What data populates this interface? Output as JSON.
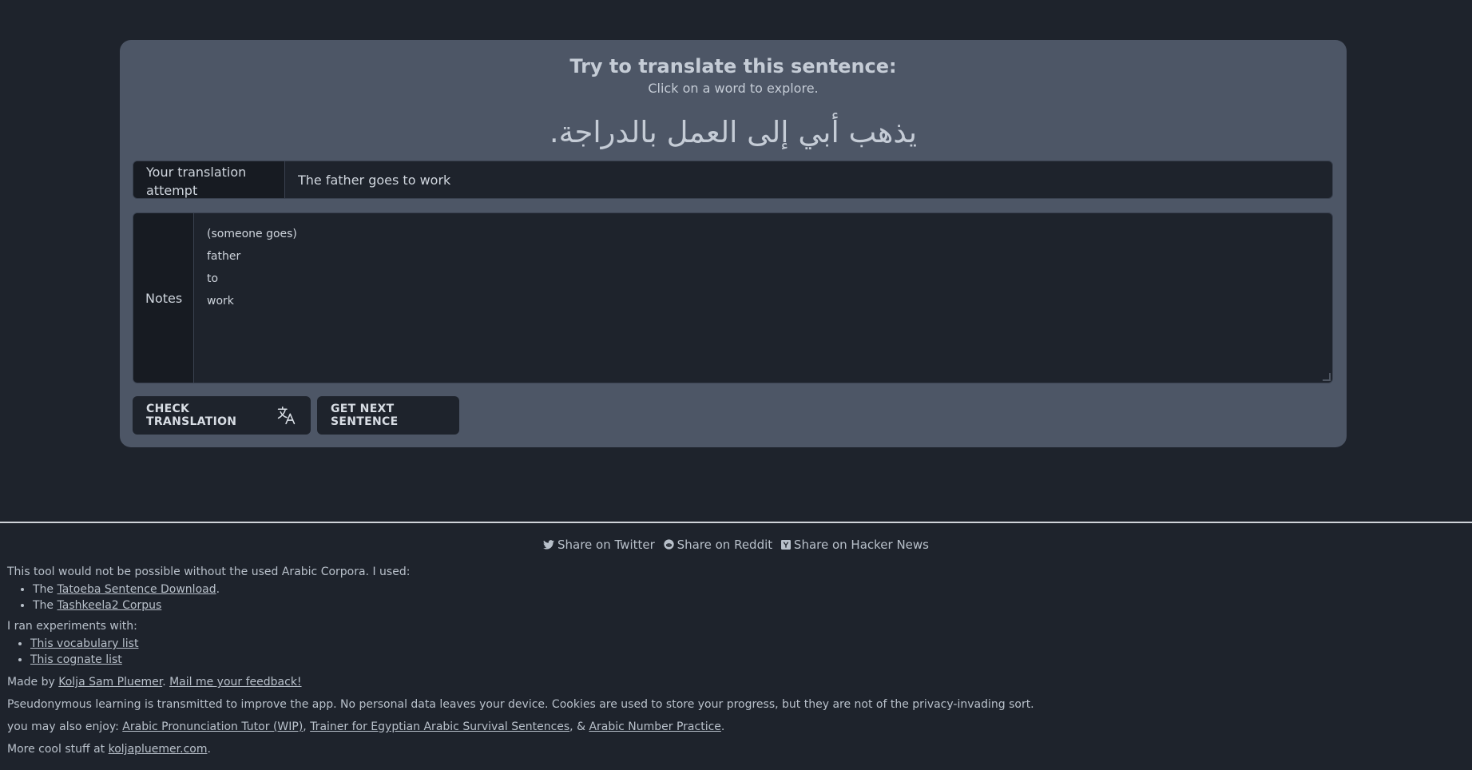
{
  "card": {
    "title": "Try to translate this sentence:",
    "subtitle": "Click on a word to explore.",
    "sentence_words": [
      "يذهب",
      "أبي",
      "إلى",
      "العمل",
      "بالدراجة."
    ]
  },
  "translation": {
    "label": "Your translation attempt",
    "value": "The father goes to work"
  },
  "notes": {
    "label": "Notes",
    "lines": [
      "(someone goes)",
      "father",
      "to",
      "work"
    ]
  },
  "buttons": {
    "check_label": "CHECK TRANSLATION",
    "check_icon": "translate-icon",
    "next_label": "GET NEXT SENTENCE"
  },
  "share": {
    "twitter": "Share on Twitter",
    "twitter_icon": "twitter-icon",
    "reddit": "Share on Reddit",
    "reddit_icon": "reddit-icon",
    "hn": "Share on Hacker News",
    "hn_icon": "hacker-news-icon"
  },
  "footer": {
    "corpora_intro": "This tool would not be possible without the used Arabic Corpora. I used:",
    "corpora": [
      {
        "prefix": "The ",
        "link": "Tatoeba Sentence Download",
        "suffix": "."
      },
      {
        "prefix": "The ",
        "link": "Tashkeela2 Corpus",
        "suffix": ""
      }
    ],
    "experiments_intro": "I ran experiments with:",
    "experiments": [
      "This vocabulary list",
      "This cognate list"
    ],
    "made_by_prefix": "Made by ",
    "author_link": "Kolja Sam Pluemer",
    "feedback_link": "Mail me your feedback!",
    "privacy": "Pseudonymous learning is transmitted to improve the app. No personal data leaves your device. Cookies are used to store your progress, but they are not of the privacy-invading sort.",
    "enjoy_prefix": "you may also enjoy: ",
    "enjoy_links": [
      "Arabic Pronunciation Tutor (WIP)",
      "Trainer for Egyptian Arabic Survival Sentences",
      "Arabic Number Practice"
    ],
    "more_prefix": "More cool stuff at ",
    "site_link": "koljapluemer.com"
  },
  "colors": {
    "background": "#1e232c",
    "card": "#4d5666",
    "field": "#1e232c"
  }
}
